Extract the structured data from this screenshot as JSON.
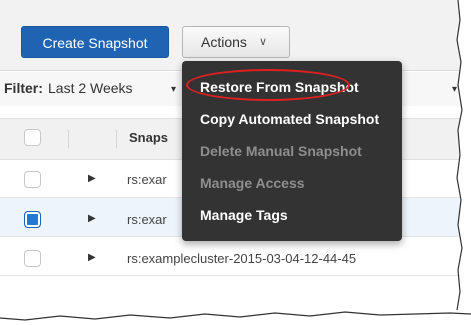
{
  "toolbar": {
    "create_label": "Create Snapshot",
    "actions_label": "Actions",
    "actions_caret": "∨"
  },
  "filter": {
    "label": "Filter:",
    "value": "Last 2 Weeks",
    "caret": "▾"
  },
  "table": {
    "header_snapshot": "Snaps",
    "rows": [
      {
        "text": "rs:exar",
        "selected": false
      },
      {
        "text": "rs:exar",
        "selected": true
      },
      {
        "text": "rs:examplecluster-2015-03-04-12-44-45",
        "selected": false
      }
    ],
    "expander": "▶"
  },
  "menu": {
    "items": [
      {
        "label": "Restore From Snapshot",
        "enabled": true,
        "highlighted": true
      },
      {
        "label": "Copy Automated Snapshot",
        "enabled": true
      },
      {
        "label": "Delete Manual Snapshot",
        "enabled": false
      },
      {
        "label": "Manage Access",
        "enabled": false
      },
      {
        "label": "Manage Tags",
        "enabled": true
      }
    ]
  },
  "colors": {
    "primary": "#1f63b3",
    "menu_bg": "#333333",
    "highlight": "#e02020",
    "checkbox_checked": "#1f7ad8"
  }
}
